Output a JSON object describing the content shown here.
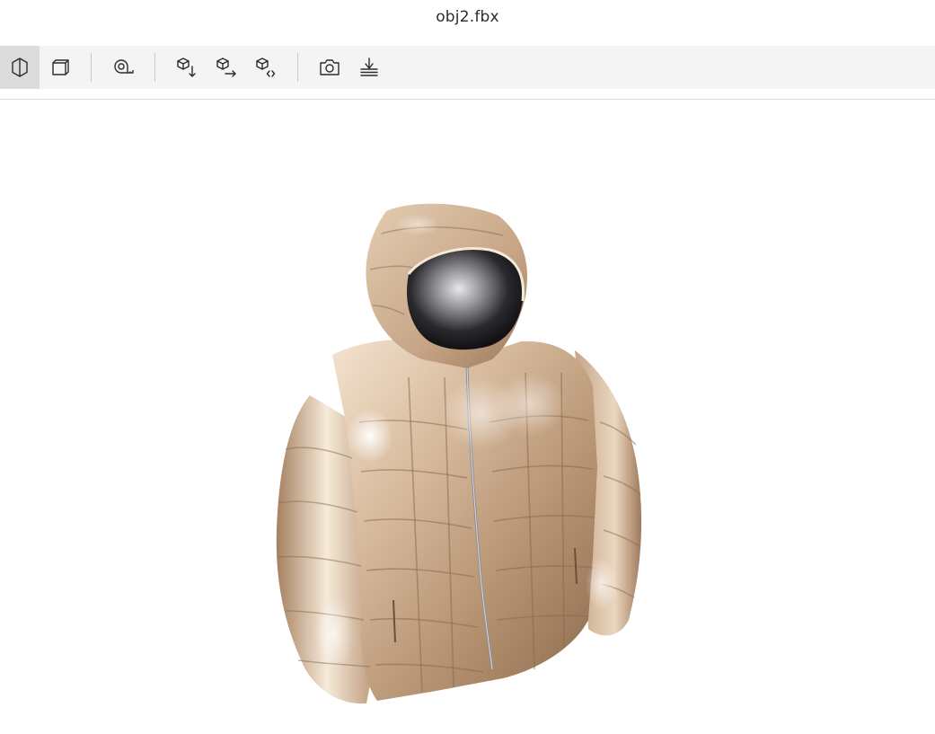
{
  "window": {
    "title": "obj2.fbx"
  },
  "toolbar": {
    "groups": [
      [
        {
          "name": "shaded-view-icon",
          "active": true
        },
        {
          "name": "wireframe-box-icon",
          "active": false
        }
      ],
      [
        {
          "name": "measure-tape-icon",
          "active": false
        }
      ],
      [
        {
          "name": "cube-down-icon",
          "active": false
        },
        {
          "name": "cube-right-icon",
          "active": false
        },
        {
          "name": "cube-code-icon",
          "active": false
        }
      ],
      [
        {
          "name": "camera-icon",
          "active": false
        },
        {
          "name": "ground-plane-icon",
          "active": false
        }
      ]
    ]
  },
  "viewport": {
    "model_subject": "puffer-jacket",
    "material_color": "#c9a888"
  }
}
